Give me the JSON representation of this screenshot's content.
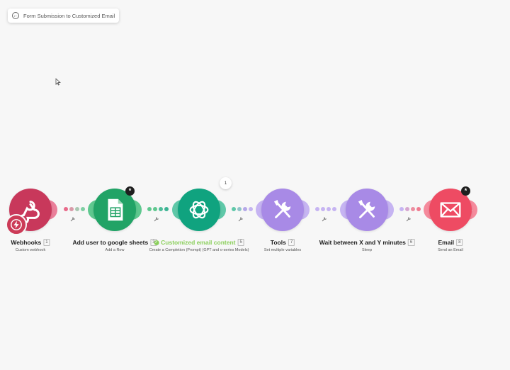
{
  "header": {
    "scenario_title": "Form Submission to Customized Email"
  },
  "modules": [
    {
      "title": "Webhooks",
      "index": "1",
      "subtitle": "Custom webhook",
      "color": "#c8385b",
      "icon": "webhook-icon"
    },
    {
      "title": "Add user to google sheets",
      "index": "3",
      "subtitle": "Add a Row",
      "color": "#21a366",
      "icon": "google-sheets-icon"
    },
    {
      "title": "Customized email content",
      "index": "5",
      "subtitle": "Create a Completion (Prompt) (GPT and o-series Models)",
      "color": "#10a37f",
      "icon": "openai-icon"
    },
    {
      "title": "Tools",
      "index": "7",
      "subtitle": "Set multiple variables",
      "color": "#a88ae6",
      "icon": "tools-icon"
    },
    {
      "title": "Wait between X and Y minutes",
      "index": "6",
      "subtitle": "Sleep",
      "color": "#a88ae6",
      "icon": "tools-icon"
    },
    {
      "title": "Email",
      "index": "8",
      "subtitle": "Send an Email",
      "color": "#ee4b63",
      "icon": "envelope-icon"
    }
  ],
  "bubble_count": "1",
  "badges": {
    "star": "*"
  }
}
